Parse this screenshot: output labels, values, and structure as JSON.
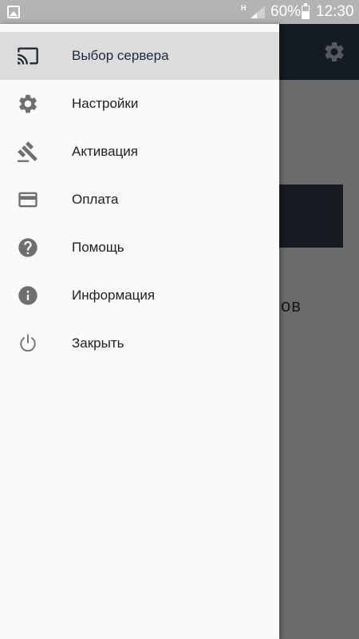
{
  "status_bar": {
    "network_type": "H",
    "battery_percent": "60%",
    "battery_level": 0.6,
    "time": "12:30"
  },
  "background_app": {
    "partial_text": "ов"
  },
  "drawer": {
    "items": [
      {
        "label": "Выбор сервера",
        "icon": "cast-icon",
        "selected": true
      },
      {
        "label": "Настройки",
        "icon": "gear-icon",
        "selected": false
      },
      {
        "label": "Активация",
        "icon": "gavel-icon",
        "selected": false
      },
      {
        "label": "Оплата",
        "icon": "credit-card-icon",
        "selected": false
      },
      {
        "label": "Помощь",
        "icon": "help-icon",
        "selected": false
      },
      {
        "label": "Информация",
        "icon": "info-icon",
        "selected": false
      },
      {
        "label": "Закрыть",
        "icon": "power-icon",
        "selected": false
      }
    ]
  },
  "colors": {
    "drawer_background": "#fafafa",
    "selected_background": "#dcdcdc",
    "icon_color": "#6f6f6f",
    "scrim": "#6b6b6b",
    "toolbar": "#151b22"
  }
}
